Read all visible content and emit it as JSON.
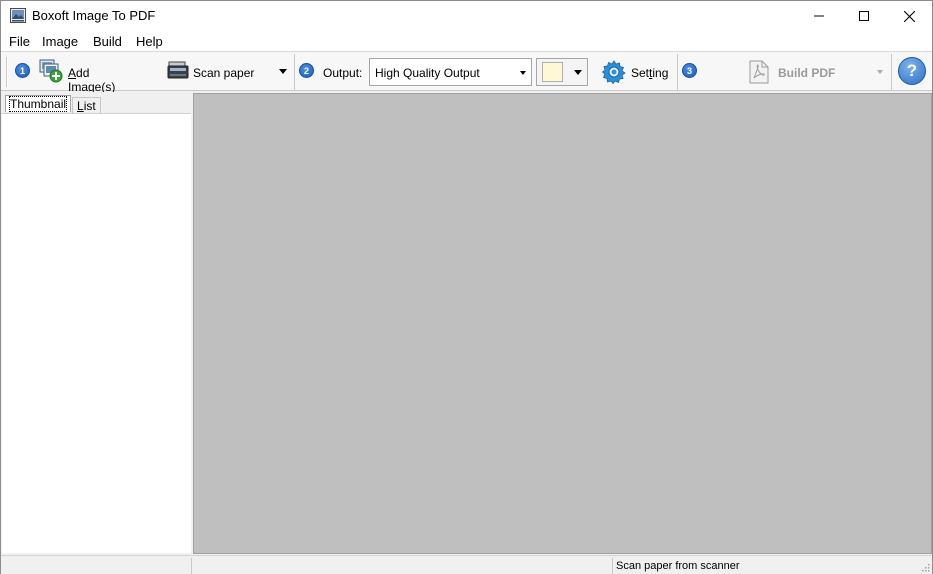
{
  "window": {
    "title": "Boxoft Image To PDF"
  },
  "menu": {
    "items": [
      "File",
      "Image",
      "Build",
      "Help"
    ]
  },
  "toolbar": {
    "step1": "1",
    "add_images_prefix": "A",
    "add_images_rest": "dd Image(s)",
    "scan_paper": "Scan paper",
    "step2": "2",
    "output_label": "Output:",
    "output_value": "High Quality Output",
    "color_value": "#fff8d4",
    "setting_prefix": "Set",
    "setting_underline": "t",
    "setting_rest": "ing",
    "step3": "3",
    "build_pdf": "Build PDF",
    "help_symbol": "?"
  },
  "tabs": {
    "thumbnail": "Thumbnail",
    "list_prefix": "L",
    "list_rest": "ist"
  },
  "status": {
    "message": "Scan paper from scanner"
  },
  "colors": {
    "preview_bg": "#bfbfbf",
    "accent_blue": "#1a5cbf"
  }
}
